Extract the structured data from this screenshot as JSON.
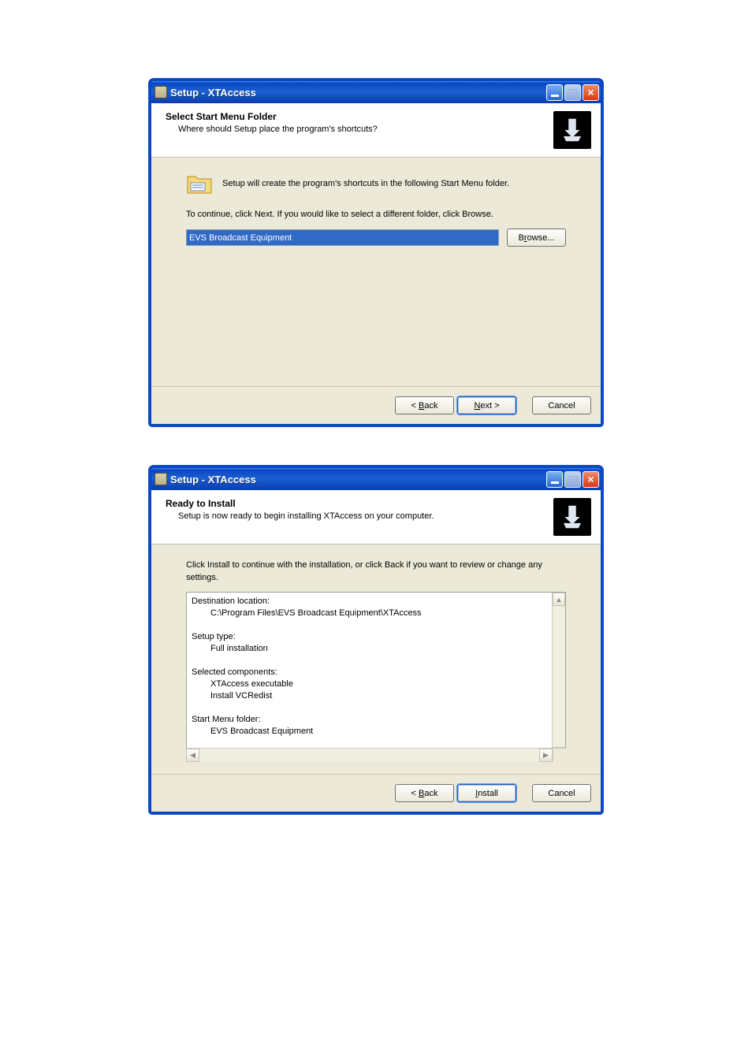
{
  "window1": {
    "title": "Setup - XTAccess",
    "header_title": "Select Start Menu Folder",
    "header_sub": "Where should Setup place the program's shortcuts?",
    "info_text": "Setup will create the program's shortcuts in the following Start Menu folder.",
    "continue_text": "To continue, click Next. If you would like to select a different folder, click Browse.",
    "input_value": "EVS Broadcast Equipment",
    "browse_label": "Browse...",
    "back_label": "< Back",
    "next_label": "Next >",
    "cancel_label": "Cancel"
  },
  "window2": {
    "title": "Setup - XTAccess",
    "header_title": "Ready to Install",
    "header_sub": "Setup is now ready to begin installing XTAccess on your computer.",
    "info_text": "Click Install to continue with the installation, or click Back if you want to review or change any settings.",
    "dest_label": "Destination location:",
    "dest_value": "C:\\Program Files\\EVS Broadcast Equipment\\XTAccess",
    "type_label": "Setup type:",
    "type_value": "Full installation",
    "comp_label": "Selected components:",
    "comp1": "XTAccess executable",
    "comp2": "Install VCRedist",
    "menu_label": "Start Menu folder:",
    "menu_value": "EVS Broadcast Equipment",
    "back_label": "< Back",
    "install_label": "Install",
    "cancel_label": "Cancel"
  }
}
